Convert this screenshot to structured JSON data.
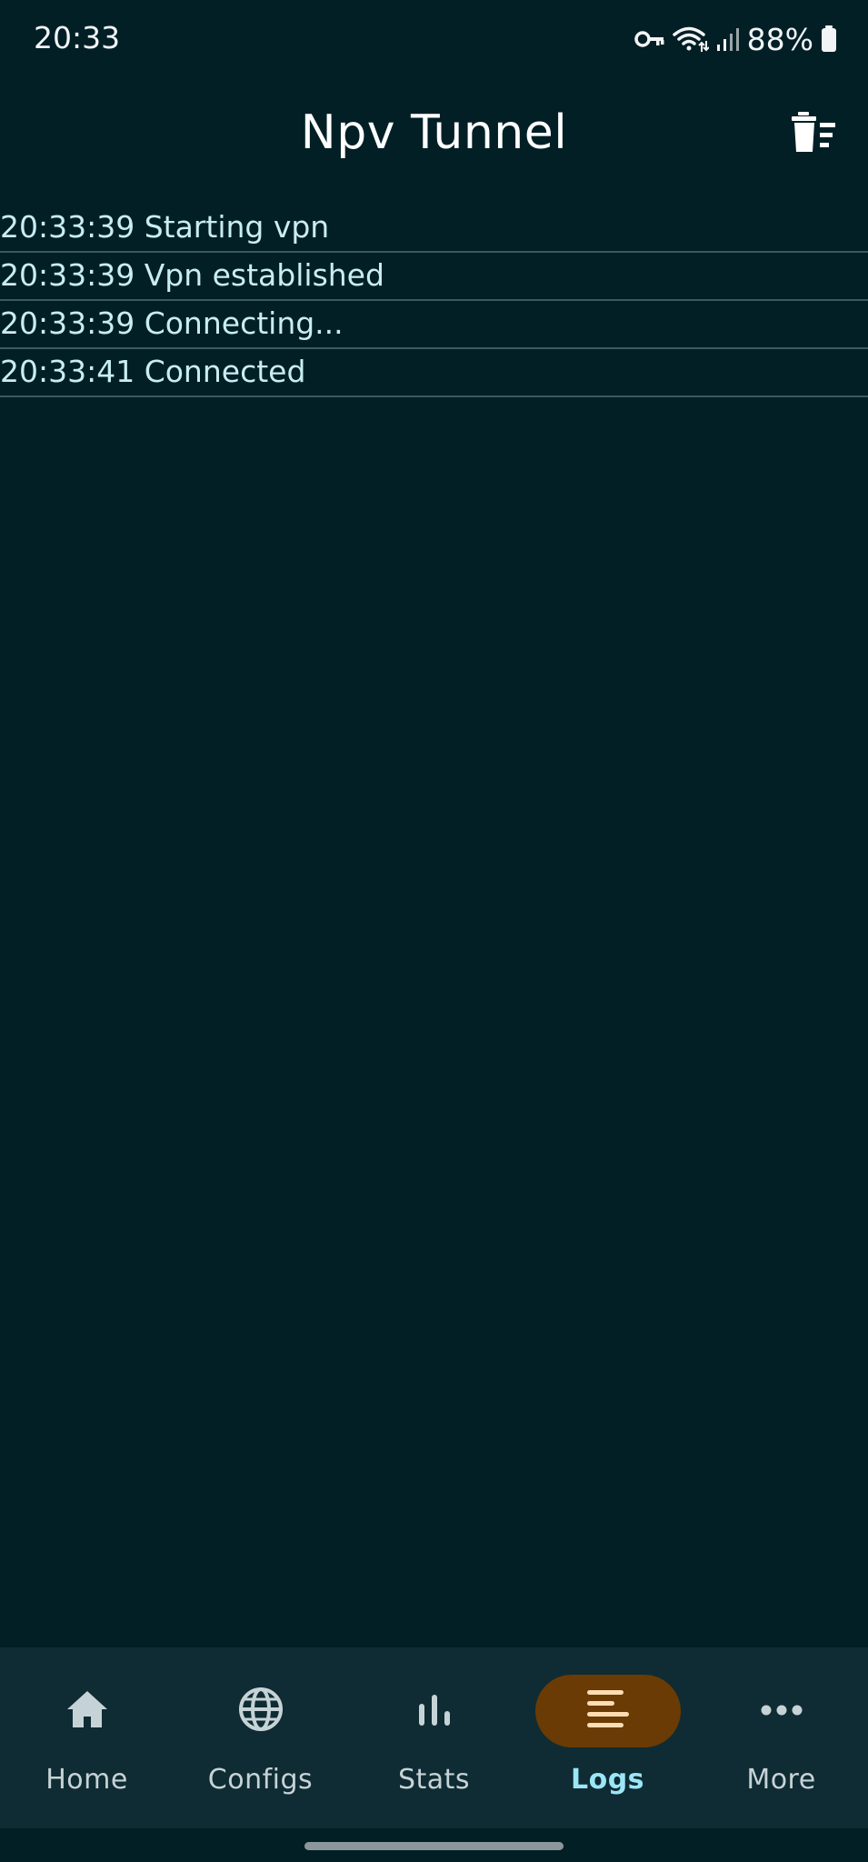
{
  "status_bar": {
    "time": "20:33",
    "battery": "88%",
    "icons": [
      "vpn-key-icon",
      "wifi-icon",
      "signal-icon",
      "battery-icon"
    ]
  },
  "app_bar": {
    "title": "Npv Tunnel",
    "action_icon": "clear-logs-icon"
  },
  "logs": [
    "20:33:39 Starting vpn",
    "20:33:39 Vpn established",
    "20:33:39 Connecting...",
    "20:33:41 Connected"
  ],
  "bottom_nav": {
    "items": [
      {
        "label": "Home",
        "icon": "home-icon",
        "active": false
      },
      {
        "label": "Configs",
        "icon": "globe-icon",
        "active": false
      },
      {
        "label": "Stats",
        "icon": "bar-chart-icon",
        "active": false
      },
      {
        "label": "Logs",
        "icon": "list-icon",
        "active": true
      },
      {
        "label": "More",
        "icon": "more-horizontal-icon",
        "active": false
      }
    ]
  },
  "colors": {
    "background": "#021f26",
    "nav_background": "#0f2b33",
    "active_pill": "#6a3b04",
    "active_label": "#9be6f6",
    "log_text": "#c8edf3"
  }
}
